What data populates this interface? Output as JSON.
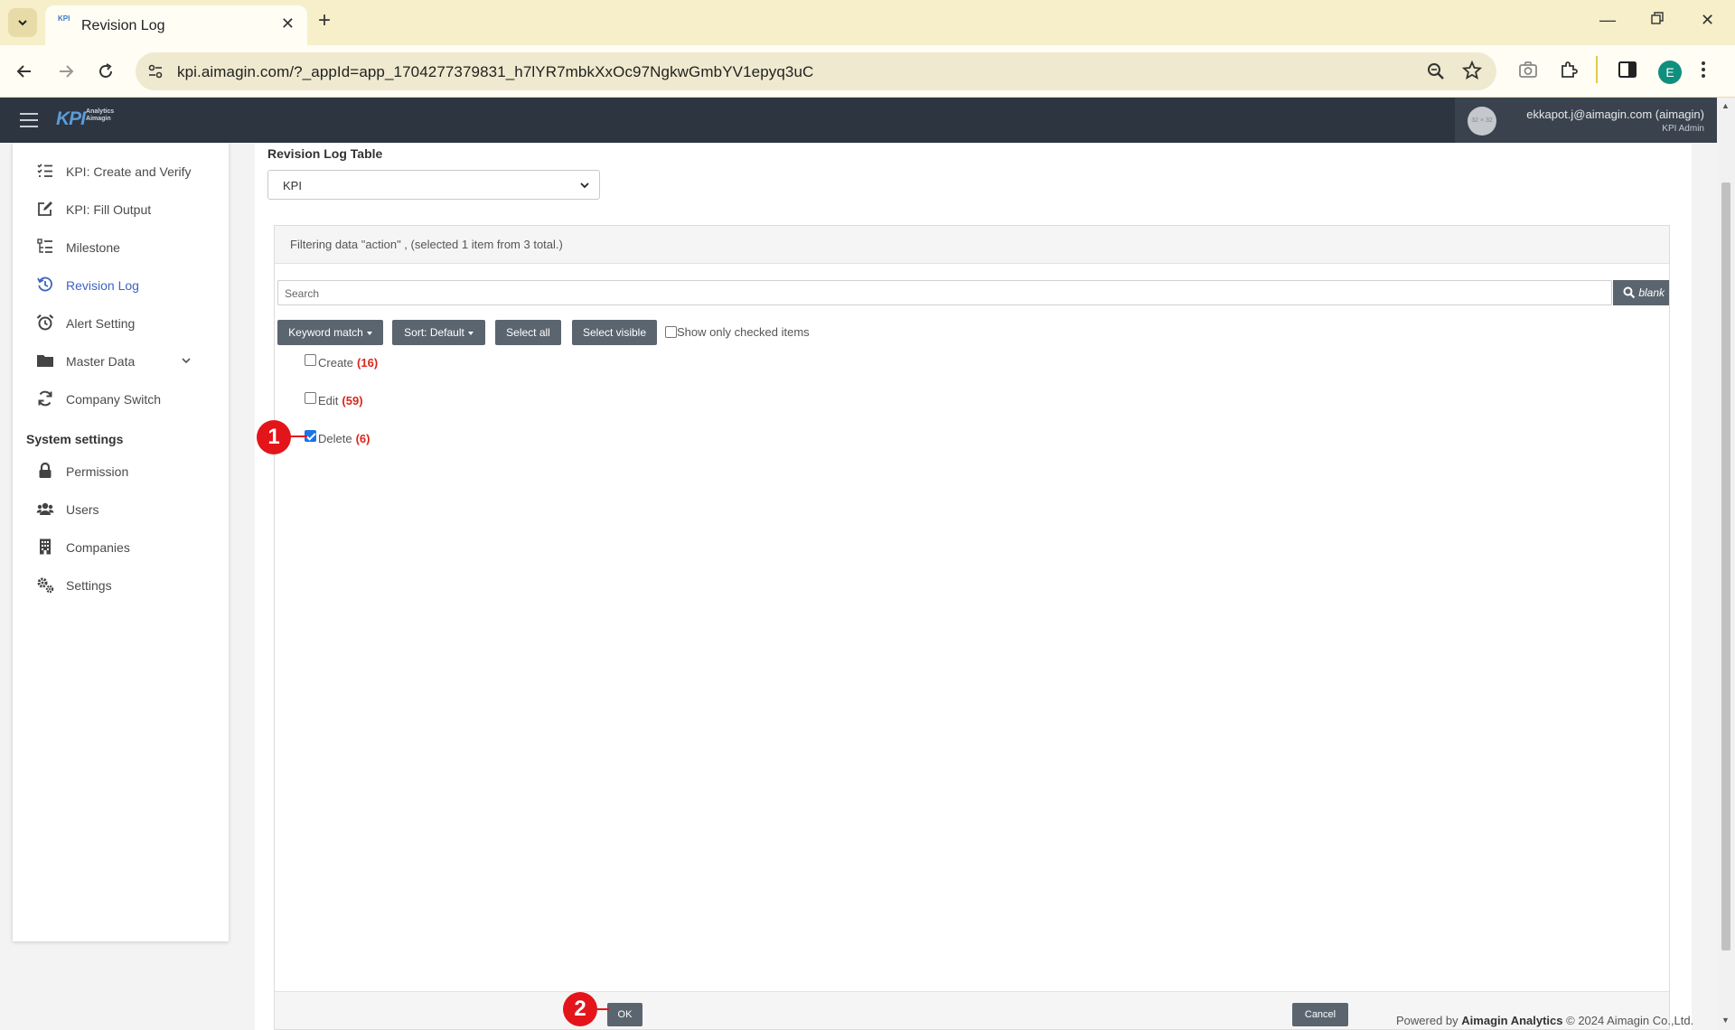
{
  "browser": {
    "tab_title": "Revision Log",
    "tab_favicon": "KPI",
    "url": "kpi.aimagin.com/?_appId=app_1704277379831_h7lYR7mbkXxOc97NgkwGmbYV1epyq3uC",
    "profile_initial": "E",
    "icons": [
      "tab-search-icon",
      "close-icon",
      "plus-icon",
      "minimize-icon",
      "restore-icon",
      "back-icon",
      "forward-icon",
      "reload-icon",
      "site-info-icon",
      "zoom-icon",
      "star-icon",
      "camera-icon",
      "extensions-icon",
      "side-panel-icon"
    ]
  },
  "header": {
    "logo": "KPI",
    "logo_sub1": "Analytics",
    "logo_sub2": "Aimagin",
    "avatar_text": "32 × 32",
    "user_email": "ekkapot.j@aimagin.com (aimagin)",
    "user_role": "KPI Admin"
  },
  "sidebar": {
    "items": [
      {
        "label": "KPI: Create and Verify",
        "icon": "list-check-icon"
      },
      {
        "label": "KPI: Fill Output",
        "icon": "edit-icon"
      },
      {
        "label": "Milestone",
        "icon": "tasks-icon"
      },
      {
        "label": "Revision Log",
        "icon": "history-icon",
        "active": true
      },
      {
        "label": "Alert Setting",
        "icon": "alarm-icon"
      },
      {
        "label": "Master Data",
        "icon": "folder-icon"
      },
      {
        "label": "Company Switch",
        "icon": "sync-icon"
      }
    ],
    "section_title": "System settings",
    "settings_items": [
      {
        "label": "Permission",
        "icon": "lock-icon"
      },
      {
        "label": "Users",
        "icon": "users-icon"
      },
      {
        "label": "Companies",
        "icon": "building-icon"
      },
      {
        "label": "Settings",
        "icon": "gears-icon"
      }
    ]
  },
  "main": {
    "table_label": "Revision Log Table",
    "table_select_value": "KPI",
    "filter": {
      "header": "Filtering data \"action\" , (selected 1 item from 3 total.)",
      "search_placeholder": "Search",
      "blank_label": "blank",
      "keyword_match_label": "Keyword match",
      "sort_label": "Sort: Default",
      "select_all_label": "Select all",
      "select_visible_label": "Select visible",
      "show_checked_label": "Show only checked items",
      "options": [
        {
          "label": "Create",
          "count": "(16)",
          "checked": false
        },
        {
          "label": "Edit",
          "count": "(59)",
          "checked": false
        },
        {
          "label": "Delete",
          "count": "(6)",
          "checked": true
        }
      ],
      "ok_label": "OK",
      "cancel_label": "Cancel"
    },
    "footer_prefix": "Powered by",
    "footer_brand": "Aimagin Analytics",
    "footer_suffix": "© 2024 Aimagin Co.,Ltd."
  },
  "annotations": {
    "marker1": "1",
    "marker2": "2",
    "color": "#e3151a"
  },
  "colors": {
    "accent": "#3e63c5",
    "button": "#5b6570",
    "header": "#2d3540",
    "count": "#d9261c"
  }
}
